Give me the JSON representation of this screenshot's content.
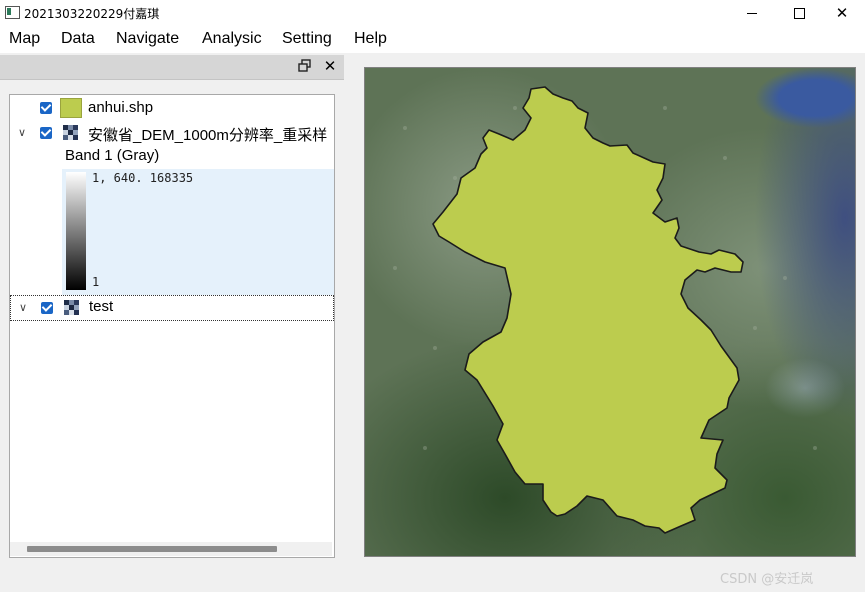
{
  "window": {
    "title": "2021303220229付嘉琪"
  },
  "menu": {
    "items": [
      "Map",
      "Data",
      "Navigate",
      "Analysic",
      "Setting",
      "Help"
    ]
  },
  "layers_panel": {
    "layers": [
      {
        "name": "anhui.shp",
        "checked": true,
        "type": "vector"
      },
      {
        "name": "安徽省_DEM_1000m分辨率_重采样",
        "checked": true,
        "type": "raster",
        "expanded": true,
        "band": "Band 1 (Gray)",
        "max_value": "1, 640. 168335",
        "min_value": "1"
      },
      {
        "name": "test",
        "checked": true,
        "type": "raster",
        "expanded": false
      }
    ]
  },
  "colors": {
    "polygon_fill": "#bccc4e",
    "checkbox": "#1a66c6",
    "legend_bg": "#e5f1fb"
  },
  "watermark": "CSDN @安迁岚"
}
